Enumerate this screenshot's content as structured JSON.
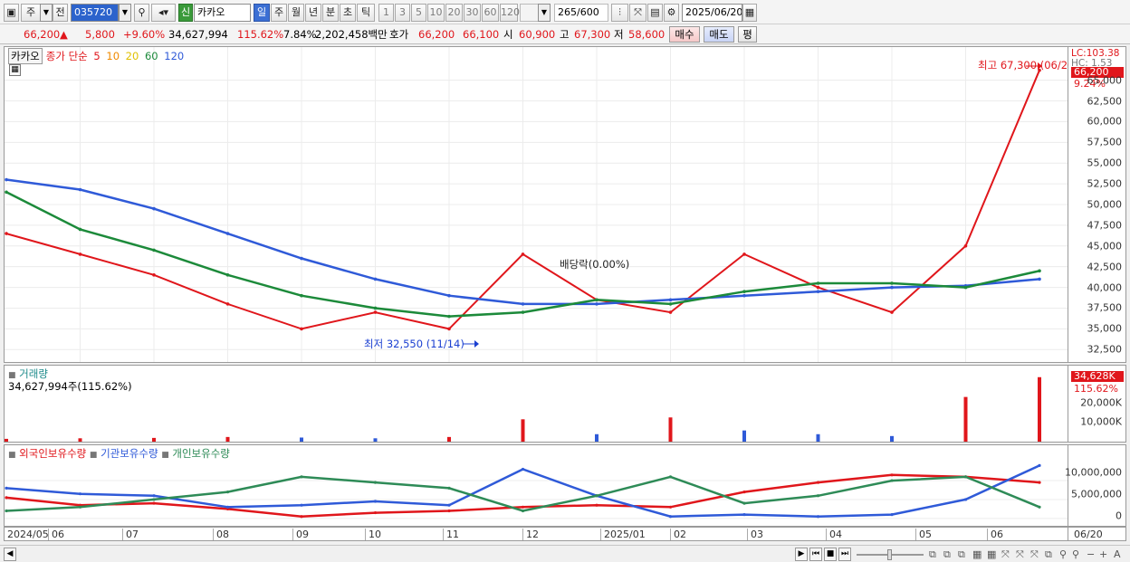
{
  "toolbar": {
    "period_type": "주",
    "prev_label": "전",
    "code": "035720",
    "stock_tag": "신",
    "stock_name": "카카오",
    "intervals": [
      "일",
      "주",
      "월",
      "년",
      "분",
      "초",
      "틱"
    ],
    "active_interval": "일",
    "ticks": [
      "1",
      "3",
      "5",
      "10",
      "20",
      "30",
      "60",
      "120"
    ],
    "count": "265",
    "count_max": "/600",
    "date": "2025/06/20"
  },
  "quote": {
    "price": "66,200",
    "up_arrow": "▲",
    "change": "5,800",
    "change_pct": "+9.60%",
    "volume": "34,627,994",
    "volume_ratio": "115.62%",
    "turnover": "7.84%",
    "amount": "2,202,458백만",
    "bid_label": "호가",
    "bid1": "66,200",
    "bid2": "66,100",
    "open_label": "시",
    "open": "60,900",
    "high_label": "고",
    "high": "67,300",
    "low_label": "저",
    "low": "58,600",
    "buy_label": "매수",
    "sell_label": "매도",
    "eval_label": "평"
  },
  "price_pane": {
    "legend_name": "카카오",
    "legend_close": "종가 단순",
    "ma_labels": [
      "5",
      "10",
      "20",
      "60",
      "120"
    ],
    "ma_colors": [
      "#e0161b",
      "#f08a00",
      "#f0d800",
      "#1c8a3a",
      "#2f5ad8"
    ],
    "lc_label": "LC:103.38",
    "hc_label": "HC: 1.53",
    "price_badge": "66,200",
    "pct_label": "9.24%",
    "ticks": [
      "65,000",
      "62,500",
      "60,000",
      "57,500",
      "55,000",
      "52,500",
      "50,000",
      "47,500",
      "45,000",
      "42,500",
      "40,000",
      "37,500",
      "35,000",
      "32,500"
    ],
    "high_annotation": "최고 67,300 (06/20)",
    "low_annotation": "최저 32,550 (11/14)",
    "dividend_annotation": "배당락(0.00%)"
  },
  "volume_pane": {
    "title": "거래량",
    "value": "34,627,994주(115.62%)",
    "badge": "34,628K",
    "ratio": "115.62%",
    "ticks": [
      "20,000K",
      "10,000K"
    ]
  },
  "holding_pane": {
    "legend": [
      "외국인보유수량",
      "기관보유수량",
      "개인보유수량"
    ],
    "colors": [
      "#e0161b",
      "#2f5ad8",
      "#2e8b57"
    ],
    "ticks": [
      "10,000,000",
      "5,000,000",
      "0"
    ]
  },
  "x_axis": [
    "2024/05",
    "06",
    "07",
    "08",
    "09",
    "10",
    "11",
    "12",
    "2025/01",
    "02",
    "03",
    "04",
    "05",
    "06"
  ],
  "x_axis_right": "06/20",
  "chart_data": [
    {
      "type": "line",
      "title": "",
      "x": [
        "2024/05",
        "06",
        "07",
        "08",
        "09",
        "10",
        "11",
        "12",
        "2025/01",
        "02",
        "03",
        "04",
        "05",
        "06",
        "06/20"
      ],
      "series": [
        {
          "name": "종가",
          "values": [
            46500,
            44000,
            41500,
            38000,
            35000,
            37000,
            35000,
            44000,
            38500,
            37000,
            44000,
            40000,
            37000,
            45000,
            66200
          ]
        },
        {
          "name": "120",
          "values": [
            53000,
            51800,
            49500,
            46500,
            43500,
            41000,
            39000,
            38000,
            38000,
            38500,
            39000,
            39500,
            40000,
            40200,
            41000
          ]
        },
        {
          "name": "60",
          "values": [
            51500,
            47000,
            44500,
            41500,
            39000,
            37500,
            36500,
            37000,
            38500,
            38000,
            39500,
            40500,
            40500,
            40000,
            42000
          ]
        }
      ],
      "ylim": [
        31000,
        69000
      ],
      "annotations": [
        "최고 67,300 (06/20)",
        "최저 32,550 (11/14)",
        "배당락(0.00%)"
      ]
    },
    {
      "type": "bar",
      "title": "거래량",
      "x": [
        "2024/05",
        "06",
        "07",
        "08",
        "09",
        "10",
        "11",
        "12",
        "2025/01",
        "02",
        "03",
        "04",
        "05",
        "06",
        "06/20"
      ],
      "values": [
        1500,
        1800,
        2000,
        2500,
        2200,
        1800,
        2500,
        12000,
        4000,
        13000,
        6000,
        4000,
        3000,
        24000,
        34628
      ],
      "unit": "K",
      "ylim": [
        0,
        35000
      ]
    },
    {
      "type": "line",
      "title": "",
      "x": [
        "2024/05",
        "06",
        "07",
        "08",
        "09",
        "10",
        "11",
        "12",
        "2025/01",
        "02",
        "03",
        "04",
        "05",
        "06",
        "06/20"
      ],
      "series": [
        {
          "name": "외국인보유수량",
          "values": [
            5500000,
            3500000,
            4000000,
            2500000,
            500000,
            1500000,
            2000000,
            3000000,
            3500000,
            3000000,
            7000000,
            9500000,
            11500000,
            11000000,
            9500000
          ]
        },
        {
          "name": "기관보유수량",
          "values": [
            8000000,
            6500000,
            6000000,
            3000000,
            3500000,
            4500000,
            3500000,
            13000000,
            6000000,
            500000,
            1000000,
            500000,
            1000000,
            5000000,
            14000000
          ]
        },
        {
          "name": "개인보유수량",
          "values": [
            2000000,
            3000000,
            5000000,
            7000000,
            11000000,
            9500000,
            8000000,
            2000000,
            6000000,
            11000000,
            4000000,
            6000000,
            10000000,
            11000000,
            3000000
          ]
        }
      ],
      "ylim": [
        -1000000,
        16000000
      ]
    }
  ]
}
